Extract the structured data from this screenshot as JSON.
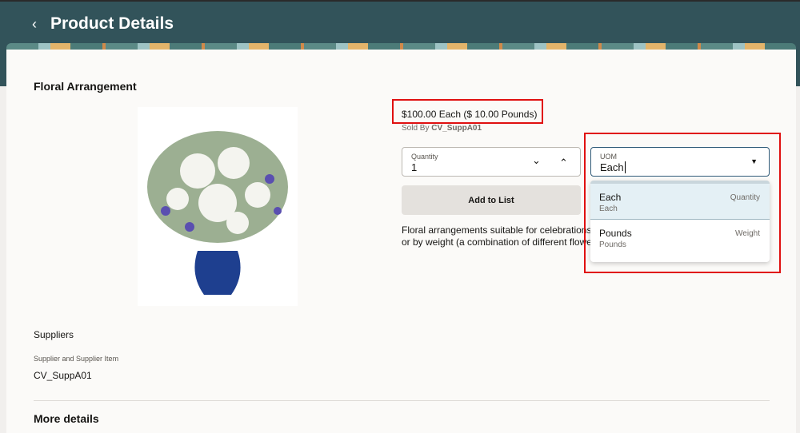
{
  "header": {
    "title": "Product Details"
  },
  "product": {
    "name": "Floral Arrangement",
    "price": "$100.00 Each ($ 10.00 Pounds)",
    "sold_by_label": "Sold By",
    "sold_by": "CV_SuppA01",
    "description": "Floral arrangements suitable for celebrations, p... or by weight (a combination of different flower...",
    "desc_line1": "Floral arrangements suitable for celebrations, p",
    "desc_line2": "or by weight (a combination of different flower"
  },
  "quantity": {
    "label": "Quantity",
    "value": "1"
  },
  "uom": {
    "label": "UOM",
    "value": "Each",
    "options": [
      {
        "label": "Each",
        "sub": "Each",
        "type": "Quantity"
      },
      {
        "label": "Pounds",
        "sub": "Pounds",
        "type": "Weight"
      }
    ]
  },
  "add_button": "Add to List",
  "suppliers": {
    "heading": "Suppliers",
    "field_label": "Supplier and Supplier Item",
    "value": "CV_SuppA01"
  },
  "more_details": "More details",
  "colors": {
    "header": "#32535a",
    "highlight": "#e01010"
  }
}
